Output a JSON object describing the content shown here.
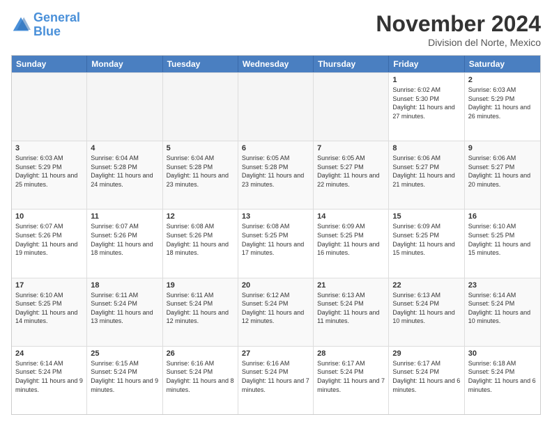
{
  "logo": {
    "line1": "General",
    "line2": "Blue"
  },
  "title": "November 2024",
  "subtitle": "Division del Norte, Mexico",
  "header_days": [
    "Sunday",
    "Monday",
    "Tuesday",
    "Wednesday",
    "Thursday",
    "Friday",
    "Saturday"
  ],
  "weeks": [
    [
      {
        "day": "",
        "info": ""
      },
      {
        "day": "",
        "info": ""
      },
      {
        "day": "",
        "info": ""
      },
      {
        "day": "",
        "info": ""
      },
      {
        "day": "",
        "info": ""
      },
      {
        "day": "1",
        "info": "Sunrise: 6:02 AM\nSunset: 5:30 PM\nDaylight: 11 hours and 27 minutes."
      },
      {
        "day": "2",
        "info": "Sunrise: 6:03 AM\nSunset: 5:29 PM\nDaylight: 11 hours and 26 minutes."
      }
    ],
    [
      {
        "day": "3",
        "info": "Sunrise: 6:03 AM\nSunset: 5:29 PM\nDaylight: 11 hours and 25 minutes."
      },
      {
        "day": "4",
        "info": "Sunrise: 6:04 AM\nSunset: 5:28 PM\nDaylight: 11 hours and 24 minutes."
      },
      {
        "day": "5",
        "info": "Sunrise: 6:04 AM\nSunset: 5:28 PM\nDaylight: 11 hours and 23 minutes."
      },
      {
        "day": "6",
        "info": "Sunrise: 6:05 AM\nSunset: 5:28 PM\nDaylight: 11 hours and 23 minutes."
      },
      {
        "day": "7",
        "info": "Sunrise: 6:05 AM\nSunset: 5:27 PM\nDaylight: 11 hours and 22 minutes."
      },
      {
        "day": "8",
        "info": "Sunrise: 6:06 AM\nSunset: 5:27 PM\nDaylight: 11 hours and 21 minutes."
      },
      {
        "day": "9",
        "info": "Sunrise: 6:06 AM\nSunset: 5:27 PM\nDaylight: 11 hours and 20 minutes."
      }
    ],
    [
      {
        "day": "10",
        "info": "Sunrise: 6:07 AM\nSunset: 5:26 PM\nDaylight: 11 hours and 19 minutes."
      },
      {
        "day": "11",
        "info": "Sunrise: 6:07 AM\nSunset: 5:26 PM\nDaylight: 11 hours and 18 minutes."
      },
      {
        "day": "12",
        "info": "Sunrise: 6:08 AM\nSunset: 5:26 PM\nDaylight: 11 hours and 18 minutes."
      },
      {
        "day": "13",
        "info": "Sunrise: 6:08 AM\nSunset: 5:25 PM\nDaylight: 11 hours and 17 minutes."
      },
      {
        "day": "14",
        "info": "Sunrise: 6:09 AM\nSunset: 5:25 PM\nDaylight: 11 hours and 16 minutes."
      },
      {
        "day": "15",
        "info": "Sunrise: 6:09 AM\nSunset: 5:25 PM\nDaylight: 11 hours and 15 minutes."
      },
      {
        "day": "16",
        "info": "Sunrise: 6:10 AM\nSunset: 5:25 PM\nDaylight: 11 hours and 15 minutes."
      }
    ],
    [
      {
        "day": "17",
        "info": "Sunrise: 6:10 AM\nSunset: 5:25 PM\nDaylight: 11 hours and 14 minutes."
      },
      {
        "day": "18",
        "info": "Sunrise: 6:11 AM\nSunset: 5:24 PM\nDaylight: 11 hours and 13 minutes."
      },
      {
        "day": "19",
        "info": "Sunrise: 6:11 AM\nSunset: 5:24 PM\nDaylight: 11 hours and 12 minutes."
      },
      {
        "day": "20",
        "info": "Sunrise: 6:12 AM\nSunset: 5:24 PM\nDaylight: 11 hours and 12 minutes."
      },
      {
        "day": "21",
        "info": "Sunrise: 6:13 AM\nSunset: 5:24 PM\nDaylight: 11 hours and 11 minutes."
      },
      {
        "day": "22",
        "info": "Sunrise: 6:13 AM\nSunset: 5:24 PM\nDaylight: 11 hours and 10 minutes."
      },
      {
        "day": "23",
        "info": "Sunrise: 6:14 AM\nSunset: 5:24 PM\nDaylight: 11 hours and 10 minutes."
      }
    ],
    [
      {
        "day": "24",
        "info": "Sunrise: 6:14 AM\nSunset: 5:24 PM\nDaylight: 11 hours and 9 minutes."
      },
      {
        "day": "25",
        "info": "Sunrise: 6:15 AM\nSunset: 5:24 PM\nDaylight: 11 hours and 9 minutes."
      },
      {
        "day": "26",
        "info": "Sunrise: 6:16 AM\nSunset: 5:24 PM\nDaylight: 11 hours and 8 minutes."
      },
      {
        "day": "27",
        "info": "Sunrise: 6:16 AM\nSunset: 5:24 PM\nDaylight: 11 hours and 7 minutes."
      },
      {
        "day": "28",
        "info": "Sunrise: 6:17 AM\nSunset: 5:24 PM\nDaylight: 11 hours and 7 minutes."
      },
      {
        "day": "29",
        "info": "Sunrise: 6:17 AM\nSunset: 5:24 PM\nDaylight: 11 hours and 6 minutes."
      },
      {
        "day": "30",
        "info": "Sunrise: 6:18 AM\nSunset: 5:24 PM\nDaylight: 11 hours and 6 minutes."
      }
    ]
  ]
}
